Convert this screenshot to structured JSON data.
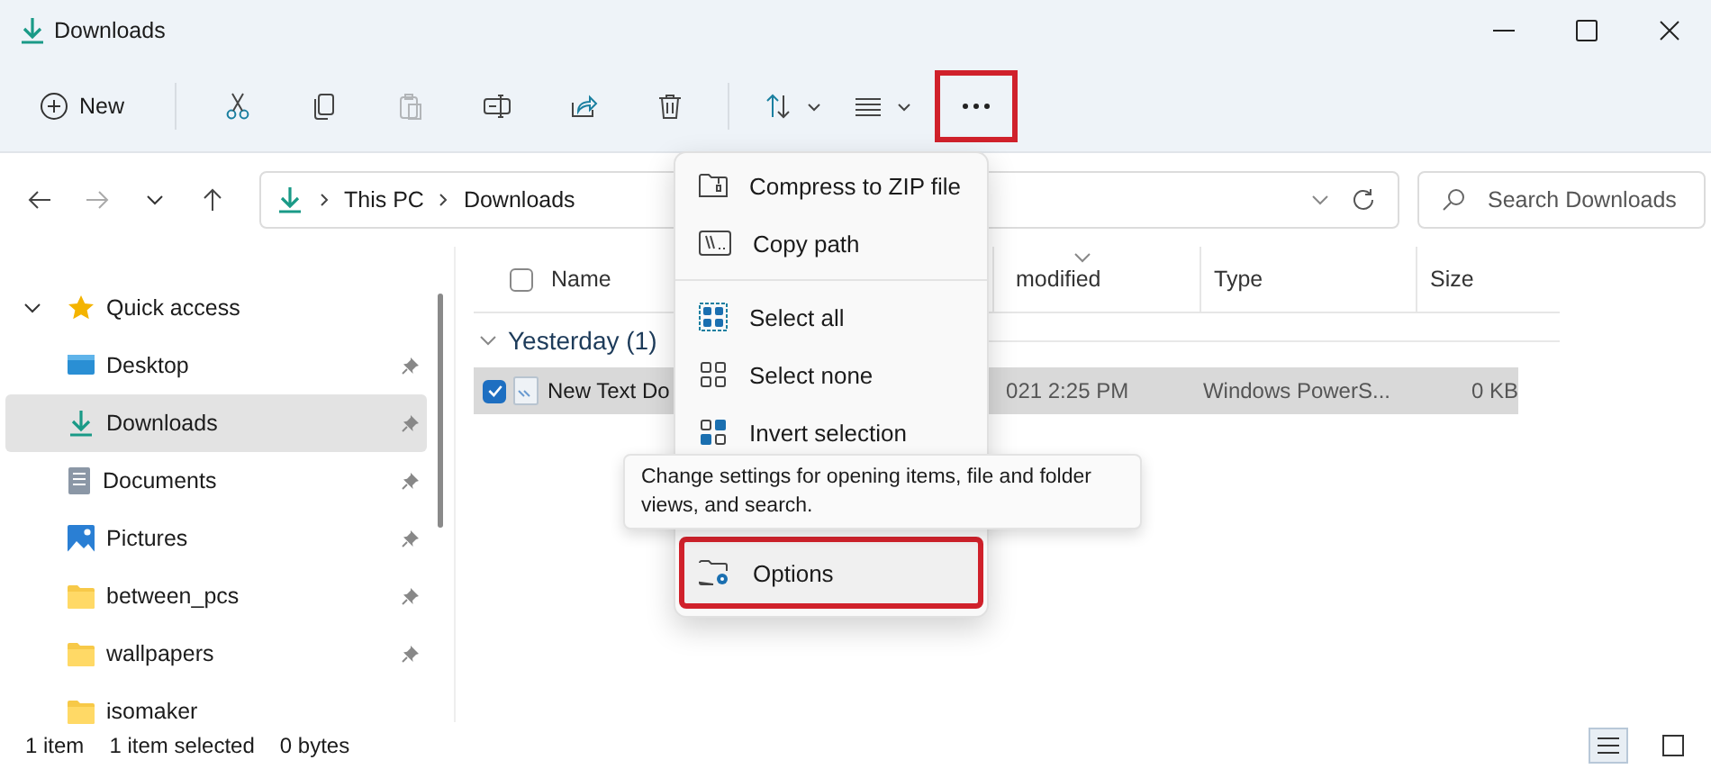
{
  "window": {
    "title": "Downloads"
  },
  "toolbar": [
    {
      "kind": "new",
      "label": "New",
      "disabled": false,
      "outlined": false
    },
    {
      "kind": "cut",
      "disabled": false,
      "outlined": false
    },
    {
      "kind": "copy",
      "disabled": false,
      "outlined": false
    },
    {
      "kind": "paste",
      "disabled": true,
      "outlined": false
    },
    {
      "kind": "rename",
      "disabled": false,
      "outlined": false
    },
    {
      "kind": "share",
      "disabled": false,
      "outlined": false
    },
    {
      "kind": "delete",
      "disabled": false,
      "outlined": false
    },
    {
      "kind": "sort",
      "disabled": false,
      "outlined": false
    },
    {
      "kind": "view",
      "disabled": false,
      "outlined": false
    },
    {
      "kind": "more",
      "disabled": false,
      "outlined": true
    }
  ],
  "address": {
    "crumbs": [
      "This PC",
      "Downloads"
    ]
  },
  "search": {
    "placeholder": "Search Downloads"
  },
  "sidebar": {
    "items": [
      {
        "label": "Quick access",
        "kind": "star",
        "expanded": true,
        "selected": false,
        "children": [
          {
            "label": "Desktop",
            "kind": "desktop",
            "pinned": true,
            "selected": false
          },
          {
            "label": "Downloads",
            "kind": "download",
            "pinned": true,
            "selected": true
          },
          {
            "label": "Documents",
            "kind": "document",
            "pinned": true,
            "selected": false
          },
          {
            "label": "Pictures",
            "kind": "pictures",
            "pinned": true,
            "selected": false
          },
          {
            "label": "between_pcs",
            "kind": "folder",
            "pinned": true,
            "selected": false
          },
          {
            "label": "wallpapers",
            "kind": "folder",
            "pinned": true,
            "selected": false
          },
          {
            "label": "isomaker",
            "kind": "folder",
            "pinned": false,
            "selected": false
          }
        ]
      }
    ]
  },
  "table": {
    "all_checked": false,
    "columns": [
      {
        "label": "Name",
        "sorted": false
      },
      {
        "label": "modified",
        "sorted": true
      },
      {
        "label": "Type",
        "sorted": false
      },
      {
        "label": "Size",
        "sorted": false
      }
    ],
    "groups": [
      {
        "label": "Yesterday (1)",
        "expanded": true,
        "rows": [
          {
            "selected": true,
            "checked": true,
            "cells": [
              "New Text Do",
              "021 2:25 PM",
              "Windows PowerS...",
              "0 KB"
            ]
          }
        ]
      }
    ]
  },
  "menu": {
    "items": [
      {
        "kind": "zip",
        "label": "Compress to ZIP file",
        "outlined": false
      },
      {
        "kind": "copypath",
        "label": "Copy path",
        "outlined": false
      },
      {
        "kind": "separator"
      },
      {
        "kind": "selectall",
        "label": "Select all",
        "outlined": false
      },
      {
        "kind": "selectnone",
        "label": "Select none",
        "outlined": false
      },
      {
        "kind": "invert",
        "label": "Invert selection",
        "outlined": false
      },
      {
        "kind": "gap"
      },
      {
        "kind": "options",
        "label": "Options",
        "outlined": true
      }
    ]
  },
  "tooltip": {
    "text": "Change settings for opening items, file and folder views, and search."
  },
  "status_bar": {
    "texts": [
      "1 item",
      "1 item selected",
      "0 bytes"
    ]
  },
  "view_buttons": [
    {
      "kind": "details",
      "selected": true
    },
    {
      "kind": "tiles",
      "selected": false
    }
  ]
}
